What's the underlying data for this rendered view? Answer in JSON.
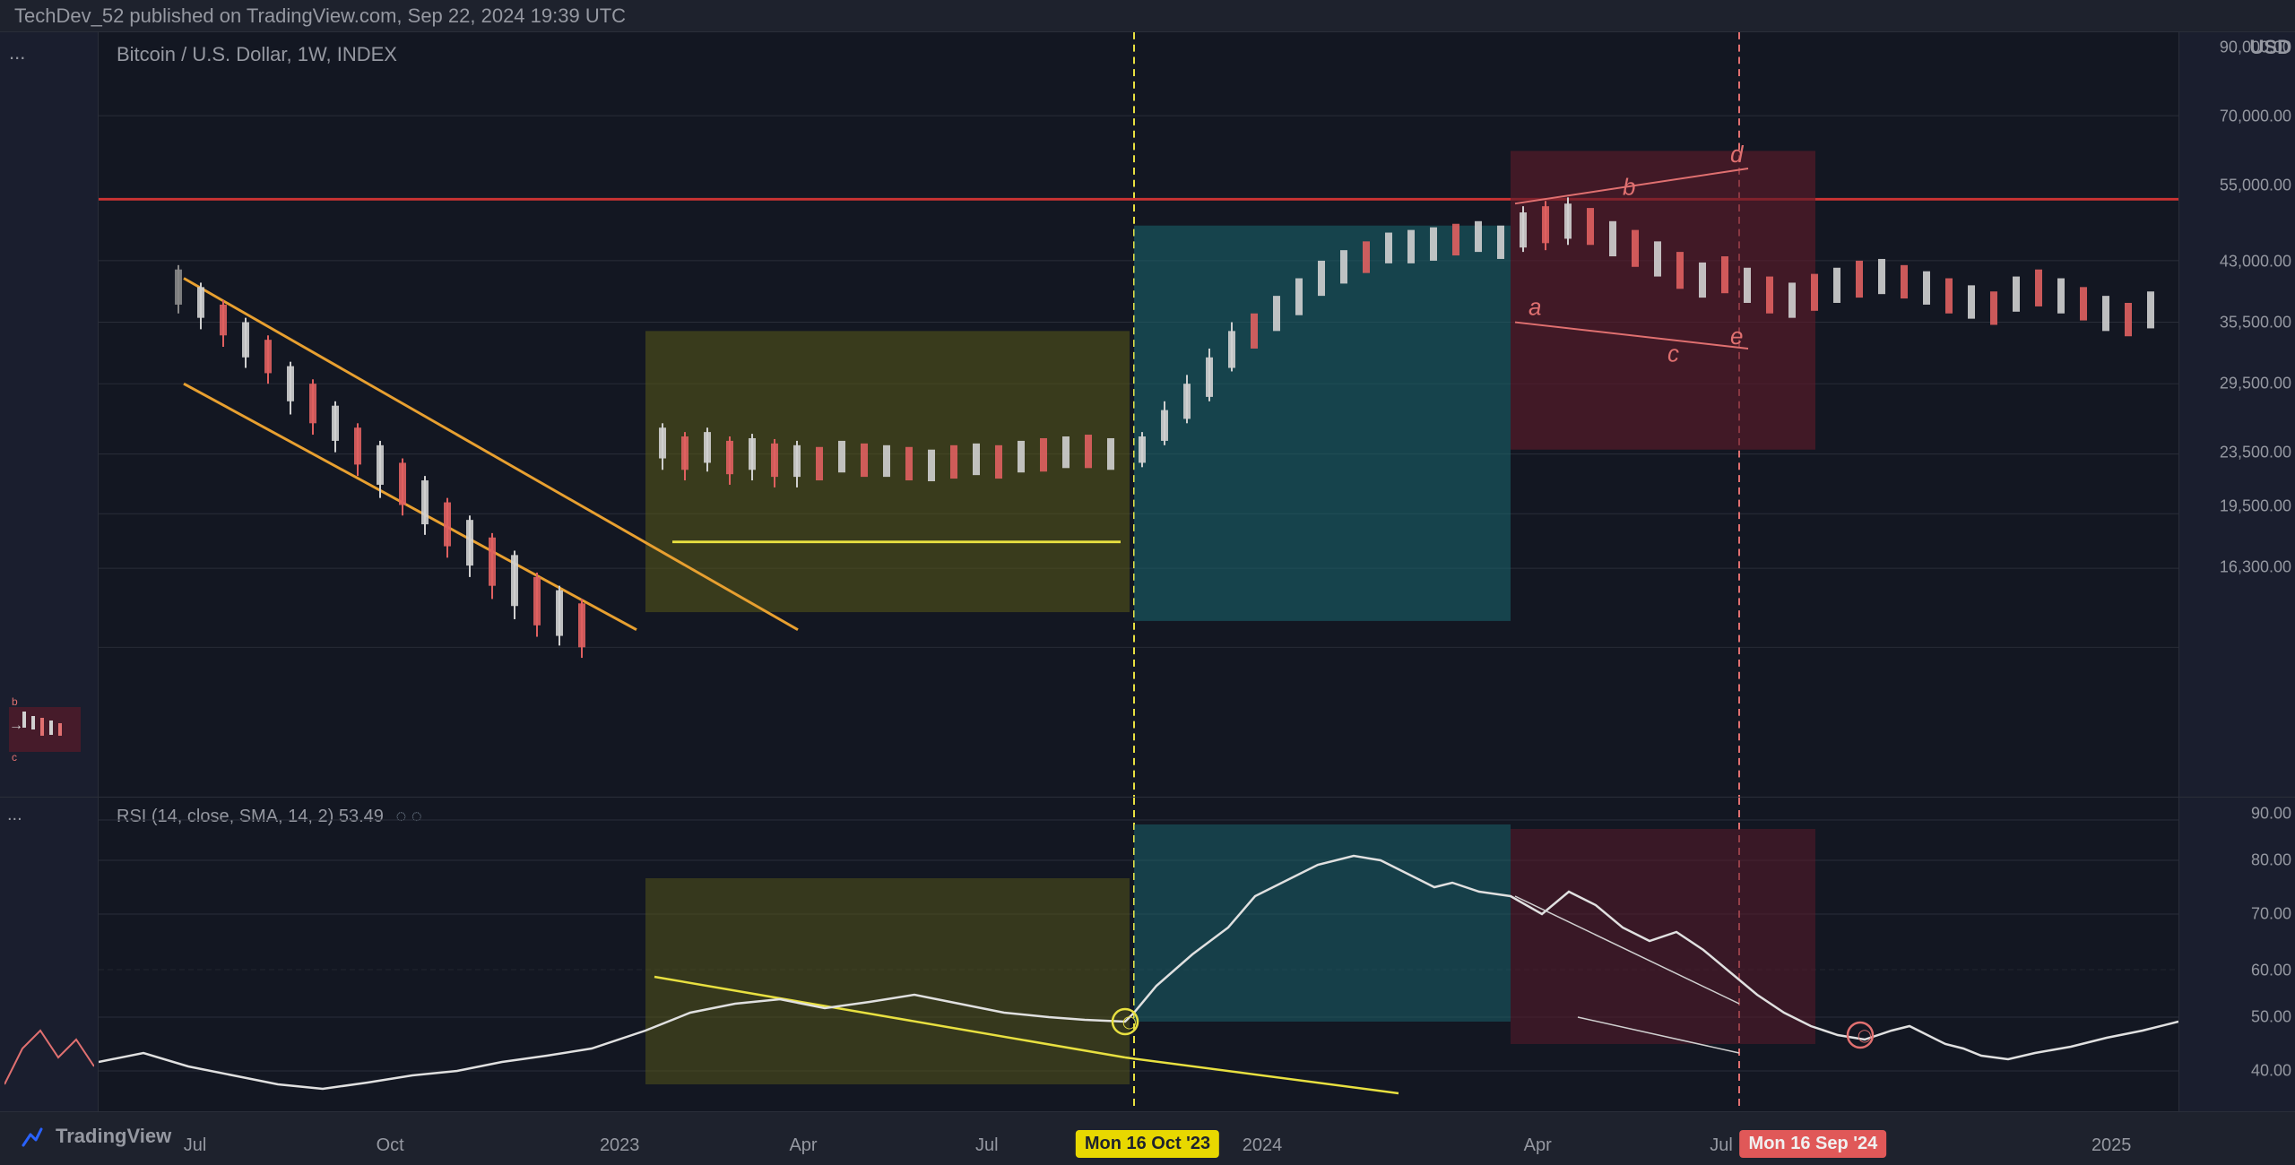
{
  "header": {
    "publisher": "TechDev_52 published on TradingView.com, Sep 22, 2024 19:39 UTC"
  },
  "chart": {
    "symbol": "Bitcoin / U.S. Dollar, 1W, INDEX",
    "currency": "USD",
    "rsi_label": "RSI (14, close, SMA, 14, 2)  53.49",
    "rsi_icon1": "◌",
    "rsi_icon2": "◌"
  },
  "price_levels": [
    {
      "value": "90,000.00",
      "pct": 2
    },
    {
      "value": "70,000.00",
      "pct": 11
    },
    {
      "value": "55,000.00",
      "pct": 20
    },
    {
      "value": "43,000.00",
      "pct": 30
    },
    {
      "value": "35,500.00",
      "pct": 38
    },
    {
      "value": "29,500.00",
      "pct": 46
    },
    {
      "value": "23,500.00",
      "pct": 55
    },
    {
      "value": "19,500.00",
      "pct": 62
    },
    {
      "value": "16,300.00",
      "pct": 70
    }
  ],
  "rsi_levels": [
    {
      "value": "90.00",
      "pct": 5
    },
    {
      "value": "80.00",
      "pct": 20
    },
    {
      "value": "70.00",
      "pct": 37
    },
    {
      "value": "60.00",
      "pct": 55
    },
    {
      "value": "50.00",
      "pct": 70
    },
    {
      "value": "40.00",
      "pct": 87
    }
  ],
  "x_axis_labels": [
    {
      "label": "Jul",
      "pct": 7
    },
    {
      "label": "Oct",
      "pct": 17
    },
    {
      "label": "2023",
      "pct": 27
    },
    {
      "label": "Apr",
      "pct": 35
    },
    {
      "label": "Jul",
      "pct": 43
    },
    {
      "label": "2024",
      "pct": 55
    },
    {
      "label": "Apr",
      "pct": 67
    },
    {
      "label": "Jul",
      "pct": 75
    },
    {
      "label": "2025",
      "pct": 92
    }
  ],
  "highlighted_dates": [
    {
      "label": "Mon 16 Oct '23",
      "pct": 50,
      "bg": "#f0e040"
    },
    {
      "label": "Mon 16 Sep '24",
      "pct": 79,
      "bg": "#f06060"
    }
  ],
  "colors": {
    "background": "#131722",
    "panel_bg": "#1a1e2e",
    "grid_line": "#2a2e39",
    "accent_yellow": "#f0e040",
    "accent_red": "#f06060",
    "red_line": "#e05050",
    "orange_line": "#e8a030",
    "yellow_line": "#e8e040",
    "teal_fill": "#1a6870",
    "olive_fill": "#5a5a18",
    "crimson_fill": "#5a1a2a"
  },
  "annotations": {
    "b_top": "b",
    "d_top": "d",
    "a_label": "a",
    "c_label": "c",
    "e_label": "e",
    "b_left": "b",
    "c_left": "c",
    "arrow": "→"
  }
}
